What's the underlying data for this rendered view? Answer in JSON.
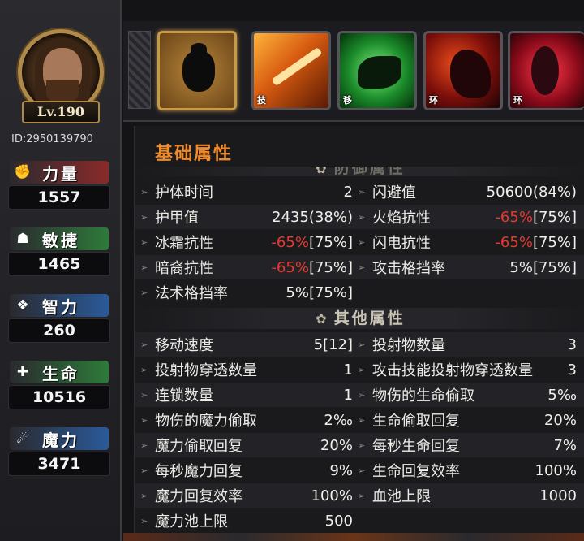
{
  "player": {
    "level": "Lv.190",
    "id": "ID:2950139790"
  },
  "stats": [
    {
      "label": "力量",
      "value": "1557",
      "icon": "fist-icon",
      "color": "#8a2a2a"
    },
    {
      "label": "敏捷",
      "value": "1465",
      "icon": "hood-icon",
      "color": "#2e7a3a"
    },
    {
      "label": "智力",
      "value": "260",
      "icon": "wing-icon",
      "color": "#2a5a9a"
    },
    {
      "label": "生命",
      "value": "10516",
      "icon": "cross-icon",
      "color": "#2e7a3a"
    },
    {
      "label": "魔力",
      "value": "3471",
      "icon": "claw-icon",
      "color": "#2a5a9a"
    }
  ],
  "skills": [
    {
      "tag": "",
      "icon": "beetle-shield-icon"
    },
    {
      "tag": "技",
      "icon": "fire-sword-icon"
    },
    {
      "tag": "移",
      "icon": "dash-shadow-icon"
    },
    {
      "tag": "环",
      "icon": "red-demon-icon"
    },
    {
      "tag": "环",
      "icon": "red-spirit-icon"
    }
  ],
  "panel_title": "基础属性",
  "defense_section": "防御属性",
  "defense_rows": [
    {
      "n1": "护体时间",
      "v1": "2",
      "n2": "闪避值",
      "v2": "50600(84%)"
    },
    {
      "n1": "护甲值",
      "v1": "2435(38%)",
      "n2": "火焰抗性",
      "v2a": "-65%",
      "v2b": "[75%]"
    },
    {
      "n1": "冰霜抗性",
      "v1a": "-65%",
      "v1b": "[75%]",
      "n2": "闪电抗性",
      "v2a": "-65%",
      "v2b": "[75%]"
    },
    {
      "n1": "暗裔抗性",
      "v1a": "-65%",
      "v1b": "[75%]",
      "n2": "攻击格挡率",
      "v2": "5%[75%]"
    },
    {
      "n1": "法术格挡率",
      "v1": "5%[75%]",
      "n2": "",
      "v2": ""
    }
  ],
  "other_section": "其他属性",
  "other_rows": [
    {
      "n1": "移动速度",
      "v1": "5[12]",
      "n2": "投射物数量",
      "v2": "3"
    },
    {
      "n1": "投射物穿透数量",
      "v1": "1",
      "n2": "攻击技能投射物穿透数量",
      "v2": "3"
    },
    {
      "n1": "连锁数量",
      "v1": "1",
      "n2": "物伤的生命偷取",
      "v2": "5‰"
    },
    {
      "n1": "物伤的魔力偷取",
      "v1": "2‰",
      "n2": "生命偷取回复",
      "v2": "20%"
    },
    {
      "n1": "魔力偷取回复",
      "v1": "20%",
      "n2": "每秒生命回复",
      "v2": "7%"
    },
    {
      "n1": "每秒魔力回复",
      "v1": "9%",
      "n2": "生命回复效率",
      "v2": "100%"
    },
    {
      "n1": "魔力回复效率",
      "v1": "100%",
      "n2": "血池上限",
      "v2": "1000"
    },
    {
      "n1": "魔力池上限",
      "v1": "500",
      "n2": "",
      "v2": ""
    }
  ]
}
